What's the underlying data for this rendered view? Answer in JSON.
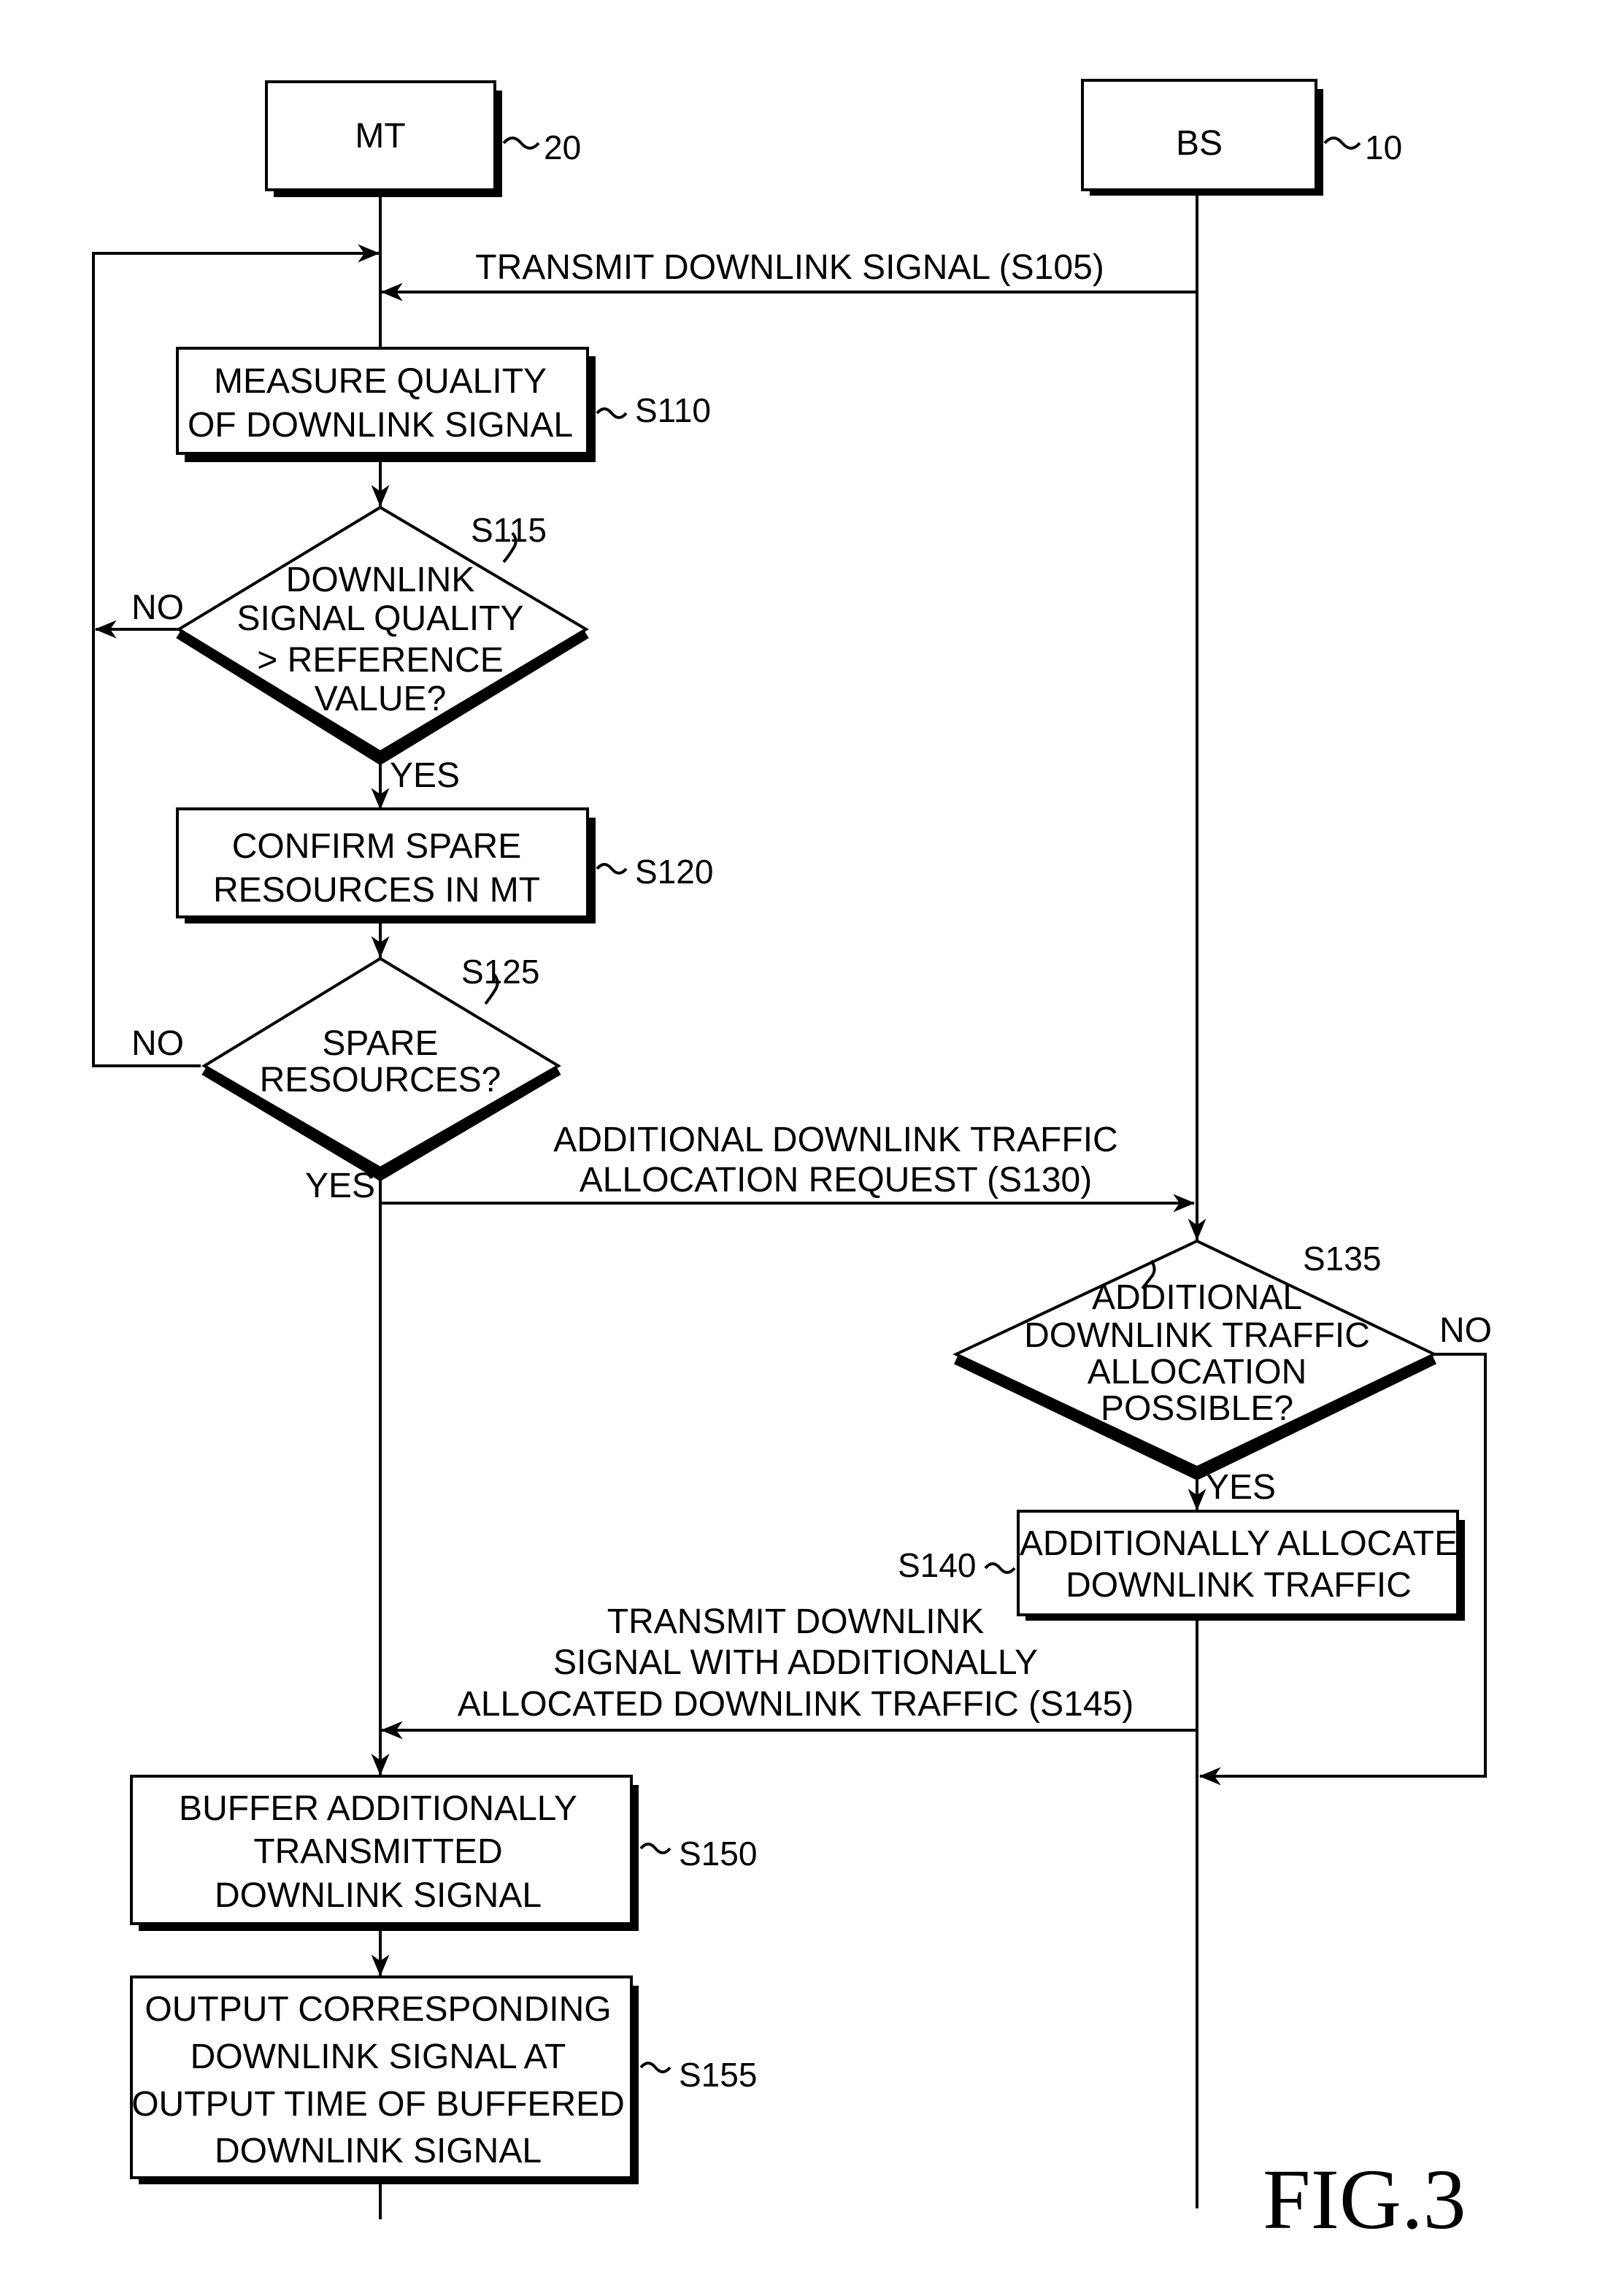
{
  "figure_label": "FIG.3",
  "entities": {
    "mt": {
      "label": "MT",
      "ref": "20"
    },
    "bs": {
      "label": "BS",
      "ref": "10"
    }
  },
  "messages": {
    "s105": {
      "lines": [
        "TRANSMIT DOWNLINK SIGNAL (S105)"
      ],
      "direction": "BS to MT"
    },
    "s130": {
      "lines": [
        "ADDITIONAL DOWNLINK TRAFFIC",
        "ALLOCATION REQUEST (S130)"
      ],
      "direction": "MT to BS"
    },
    "s145": {
      "lines": [
        "TRANSMIT DOWNLINK",
        "SIGNAL WITH ADDITIONALLY",
        "ALLOCATED DOWNLINK TRAFFIC (S145)"
      ],
      "direction": "BS to MT"
    }
  },
  "steps": {
    "s110": {
      "ref": "S110",
      "lines": [
        "MEASURE QUALITY",
        "OF DOWNLINK SIGNAL"
      ]
    },
    "s115": {
      "ref": "S115",
      "lines": [
        "DOWNLINK",
        "SIGNAL QUALITY",
        "> REFERENCE",
        "VALUE?"
      ],
      "yes": "YES",
      "no": "NO"
    },
    "s120": {
      "ref": "S120",
      "lines": [
        "CONFIRM SPARE",
        "RESOURCES IN MT"
      ]
    },
    "s125": {
      "ref": "S125",
      "lines": [
        "SPARE",
        "RESOURCES?"
      ],
      "yes": "YES",
      "no": "NO"
    },
    "s135": {
      "ref": "S135",
      "lines": [
        "ADDITIONAL",
        "DOWNLINK TRAFFIC",
        "ALLOCATION",
        "POSSIBLE?"
      ],
      "yes": "YES",
      "no": "NO"
    },
    "s140": {
      "ref": "S140",
      "lines": [
        "ADDITIONALLY ALLOCATE",
        "DOWNLINK TRAFFIC"
      ]
    },
    "s150": {
      "ref": "S150",
      "lines": [
        "BUFFER ADDITIONALLY",
        "TRANSMITTED",
        "DOWNLINK SIGNAL"
      ]
    },
    "s155": {
      "ref": "S155",
      "lines": [
        "OUTPUT CORRESPONDING",
        "DOWNLINK SIGNAL AT",
        "OUTPUT TIME OF BUFFERED",
        "DOWNLINK SIGNAL"
      ]
    }
  }
}
